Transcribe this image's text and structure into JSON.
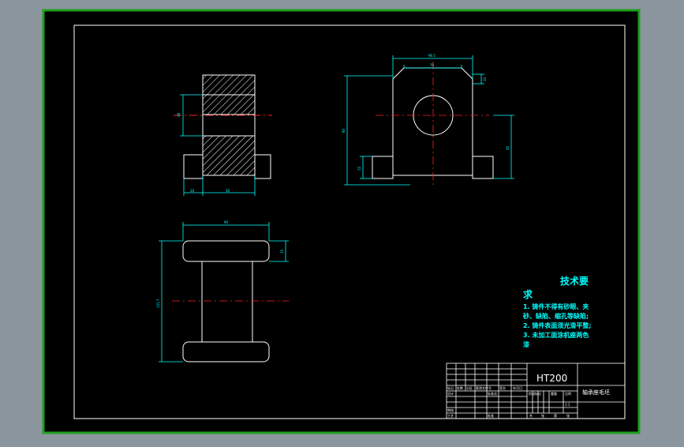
{
  "colors": {
    "background": "#8b959e",
    "sheet": "#000000",
    "sheet_border": "#1ea01e",
    "frame": "#ffffff",
    "dimension": "#00ffff",
    "centerline": "#ff1e1e",
    "text_cyan": "#00ffff",
    "text_white": "#ffffff"
  },
  "tech_requirements": {
    "title_line1": "技术要",
    "title_line2": "求",
    "items": [
      "1. 铸件不得有砂眼、夹",
      "砂、缺陷、缩孔等缺陷;",
      "2. 铸件表面须光滑平整;",
      "3. 未加工面涂机座两色",
      "漆"
    ]
  },
  "title_block": {
    "material": "HT200",
    "part_name": "轴承座毛坯",
    "scale": "1:1",
    "header_row": [
      "标记",
      "处数",
      "分区",
      "更改文件号",
      "签名",
      "年月日"
    ],
    "design_label": "设计",
    "standard_label": "标准化",
    "stage_labels": [
      "阶段标记",
      "重量",
      "比例"
    ],
    "review_label": "审核",
    "process_label": "工艺",
    "approve_label": "批准",
    "sheet_info": [
      "共",
      "张",
      "第",
      "张"
    ]
  },
  "dimensions": {
    "front_total_width": "96.5",
    "front_top_width": "70",
    "front_chamfer": "10",
    "front_total_height": "80",
    "front_foot_height": "15",
    "front_right_height": "45",
    "side_bore": "48",
    "side_foot": "20",
    "side_width": "50",
    "top_width": "90",
    "top_flange": "15",
    "top_length": "131.7"
  }
}
